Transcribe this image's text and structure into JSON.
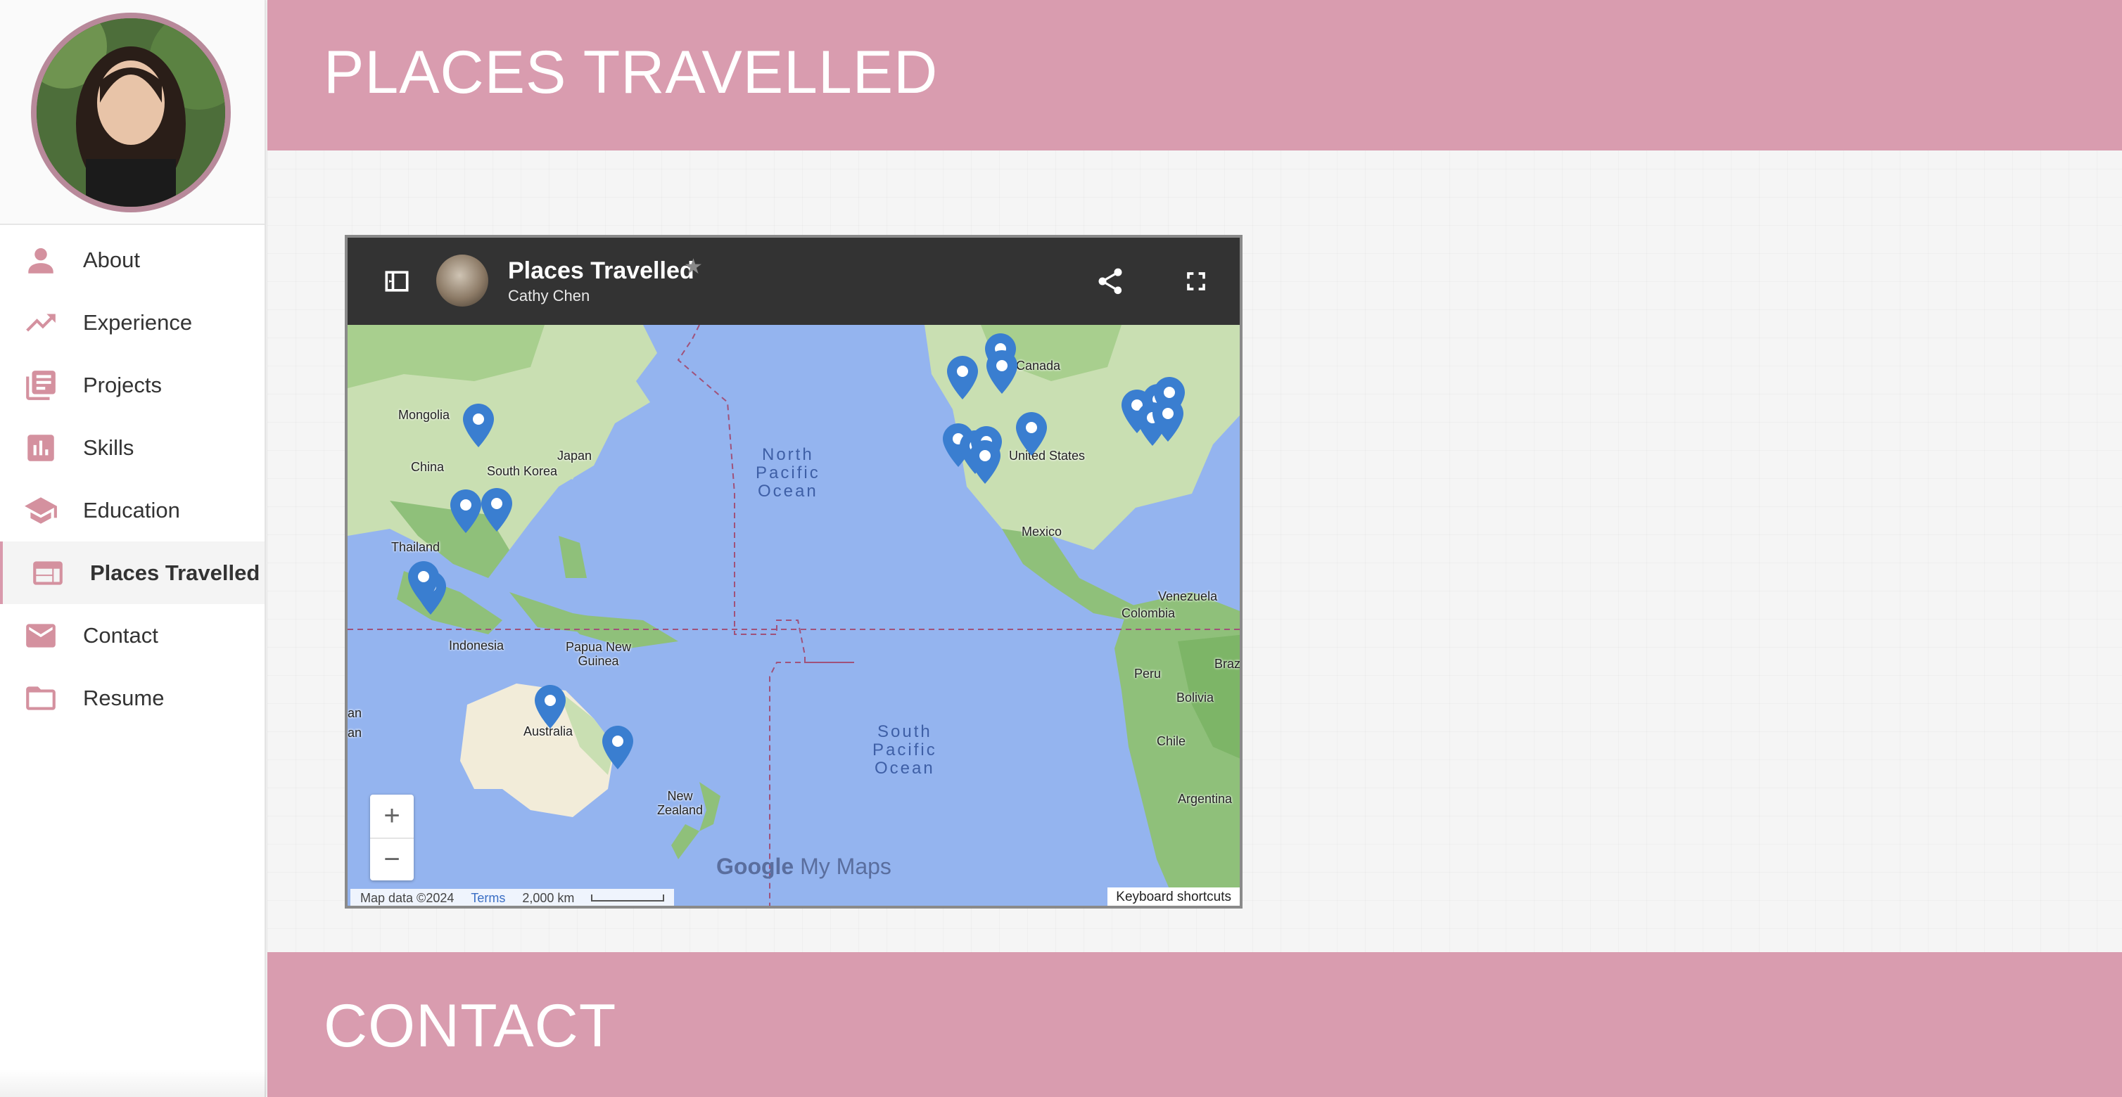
{
  "sidebar": {
    "items": [
      {
        "label": "About",
        "icon": "person-icon"
      },
      {
        "label": "Experience",
        "icon": "trending-up-icon"
      },
      {
        "label": "Projects",
        "icon": "library-books-icon"
      },
      {
        "label": "Skills",
        "icon": "bar-chart-icon"
      },
      {
        "label": "Education",
        "icon": "school-icon"
      },
      {
        "label": "Places Travelled",
        "icon": "web-icon",
        "active": true
      },
      {
        "label": "Contact",
        "icon": "mail-icon"
      },
      {
        "label": "Resume",
        "icon": "folder-icon"
      }
    ]
  },
  "sections": {
    "places_title": "PLACES TRAVELLED",
    "contact_title": "CONTACT"
  },
  "map": {
    "title": "Places Travelled",
    "author": "Cathy Chen",
    "star": "★",
    "zoom_in": "+",
    "zoom_out": "−",
    "logo_google": "Google",
    "logo_mymaps": "My Maps",
    "attribution": "Map data ©2024",
    "terms": "Terms",
    "scale": "2,000 km",
    "keyboard": "Keyboard shortcuts",
    "labels": {
      "mongolia": "Mongolia",
      "china": "China",
      "south_korea": "South Korea",
      "japan": "Japan",
      "thailand": "Thailand",
      "indonesia": "Indonesia",
      "papua": "Papua New\nGuinea",
      "australia": "Australia",
      "new_zealand": "New\nZealand",
      "canada": "Canada",
      "united_states": "United States",
      "mexico": "Mexico",
      "venezuela": "Venezuela",
      "colombia": "Colombia",
      "peru": "Peru",
      "bolivia": "Bolivia",
      "brazil": "Brazi",
      "chile": "Chile",
      "argentina": "Argentina",
      "edge_an": "an\nan"
    },
    "oceans": {
      "north_pacific": "North\nPacific\nOcean",
      "south_pacific": "South\nPacific\nOcean"
    }
  },
  "colors": {
    "header_pink": "#d99caf",
    "icon_pink": "#d4919f",
    "pin_blue": "#3a7ed0"
  }
}
